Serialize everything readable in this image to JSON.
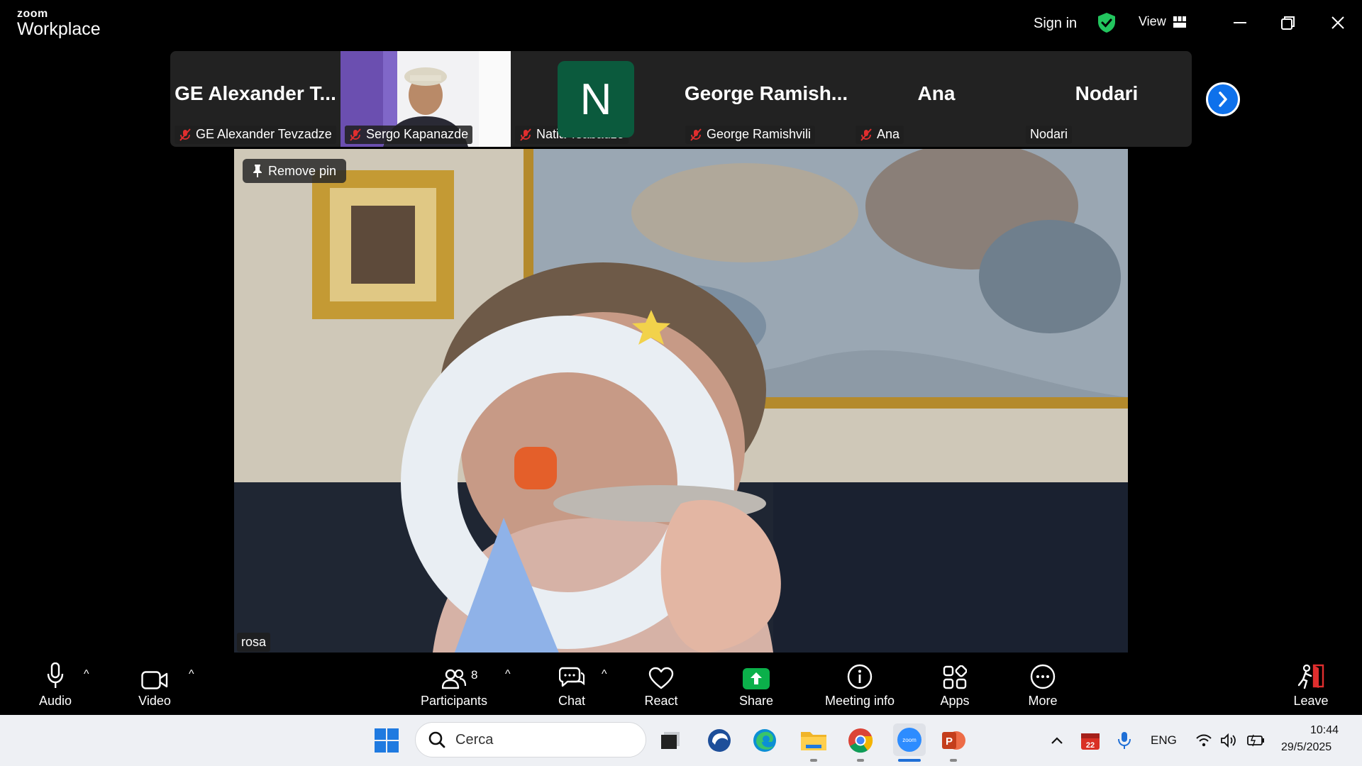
{
  "app": {
    "logo_line1": "zoom",
    "logo_line2": "Workplace"
  },
  "titlebar": {
    "sign_in": "Sign in",
    "view_label": "View"
  },
  "gallery": {
    "tiles": [
      {
        "big_name": "GE Alexander T...",
        "label": "GE Alexander Tevzadze",
        "muted": true
      },
      {
        "big_name": "",
        "label": "Sergo Kapanazde",
        "muted": true
      },
      {
        "big_name": "",
        "avatar_letter": "N",
        "label": "Natia Tsabadze",
        "muted": true
      },
      {
        "big_name": "George  Ramish...",
        "label": "George Ramishvili",
        "muted": true
      },
      {
        "big_name": "Ana",
        "label": "Ana",
        "muted": true
      },
      {
        "big_name": "Nodari",
        "label": "Nodari",
        "muted": false
      }
    ]
  },
  "main_video": {
    "pin_label": "Remove pin",
    "speaker_name": "rosa"
  },
  "toolbar": {
    "audio": "Audio",
    "video": "Video",
    "participants": "Participants",
    "participants_count": "8",
    "chat": "Chat",
    "react": "React",
    "share": "Share",
    "meeting_info": "Meeting info",
    "apps": "Apps",
    "more": "More",
    "leave": "Leave"
  },
  "taskbar": {
    "search_placeholder": "Cerca",
    "language": "ENG",
    "time": "10:44",
    "date": "29/5/2025",
    "calendar_badge": "22"
  },
  "colors": {
    "accent_blue": "#0e71eb",
    "share_green": "#0bb04a",
    "shield_green": "#22c55e",
    "avatar_green": "#0b5a3d",
    "mute_red": "#e02e2e",
    "leave_red": "#e02e2e"
  }
}
